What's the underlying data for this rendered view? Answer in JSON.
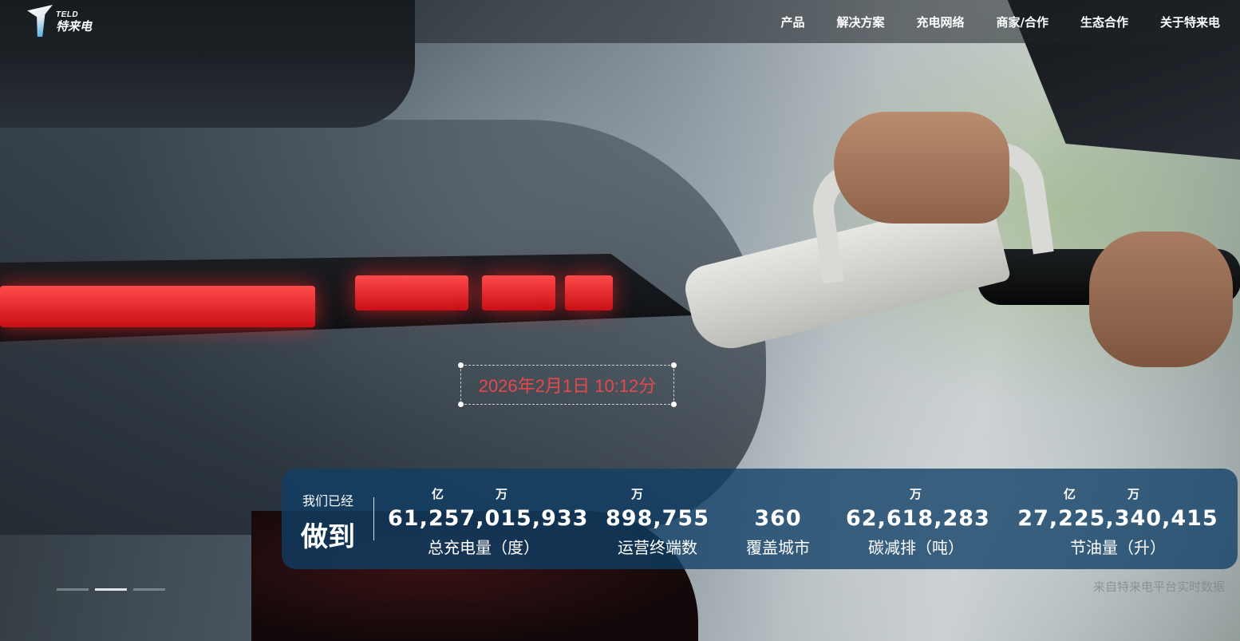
{
  "brand": {
    "logo_en": "TELD",
    "logo_cn": "特来电"
  },
  "nav": {
    "items": [
      "产品",
      "解决方案",
      "充电网络",
      "商家/合作",
      "生态合作",
      "关于特来电"
    ]
  },
  "date_overlay": {
    "text": "2026年2月1日 10:12分",
    "color": "#e5484d"
  },
  "stats": {
    "intro_small": "我们已经",
    "intro_big": "做到",
    "items": [
      {
        "value": "61,257,015,933",
        "label": "总充电量（度）",
        "units": [
          "亿",
          "万"
        ]
      },
      {
        "value": "898,755",
        "label": "运营终端数",
        "units": [
          "万"
        ]
      },
      {
        "value": "360",
        "label": "覆盖城市",
        "units": []
      },
      {
        "value": "62,618,283",
        "label": "碳减排（吨）",
        "units": [
          "万"
        ]
      },
      {
        "value": "27,225,340,415",
        "label": "节油量（升）",
        "units": [
          "亿",
          "万"
        ]
      }
    ],
    "panel_color": "#103f66"
  },
  "source_note": "来自特来电平台实时数据",
  "carousel": {
    "count": 3,
    "active_index": 1
  }
}
